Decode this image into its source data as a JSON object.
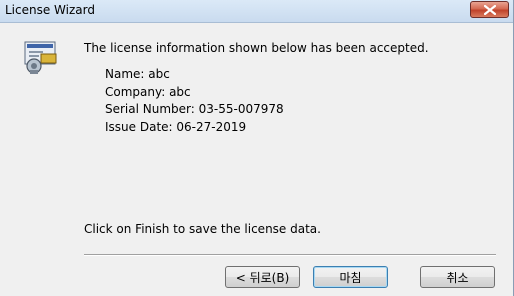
{
  "window": {
    "title": "License Wizard"
  },
  "icons": {
    "app": "license-certificate-icon",
    "close": "close-icon"
  },
  "content": {
    "message": "The license information shown below has been accepted.",
    "details": {
      "name": "Name: abc",
      "company": "Company: abc",
      "serial": "Serial Number: 03-55-007978",
      "issue_date": "Issue Date: 06-27-2019"
    },
    "footer": "Click on Finish to save the license data."
  },
  "buttons": {
    "back": "< 뒤로(B)",
    "finish": "마침",
    "cancel": "취소"
  },
  "colors": {
    "close_button": "#c9462c",
    "default_button_border": "#3c7fb1"
  }
}
